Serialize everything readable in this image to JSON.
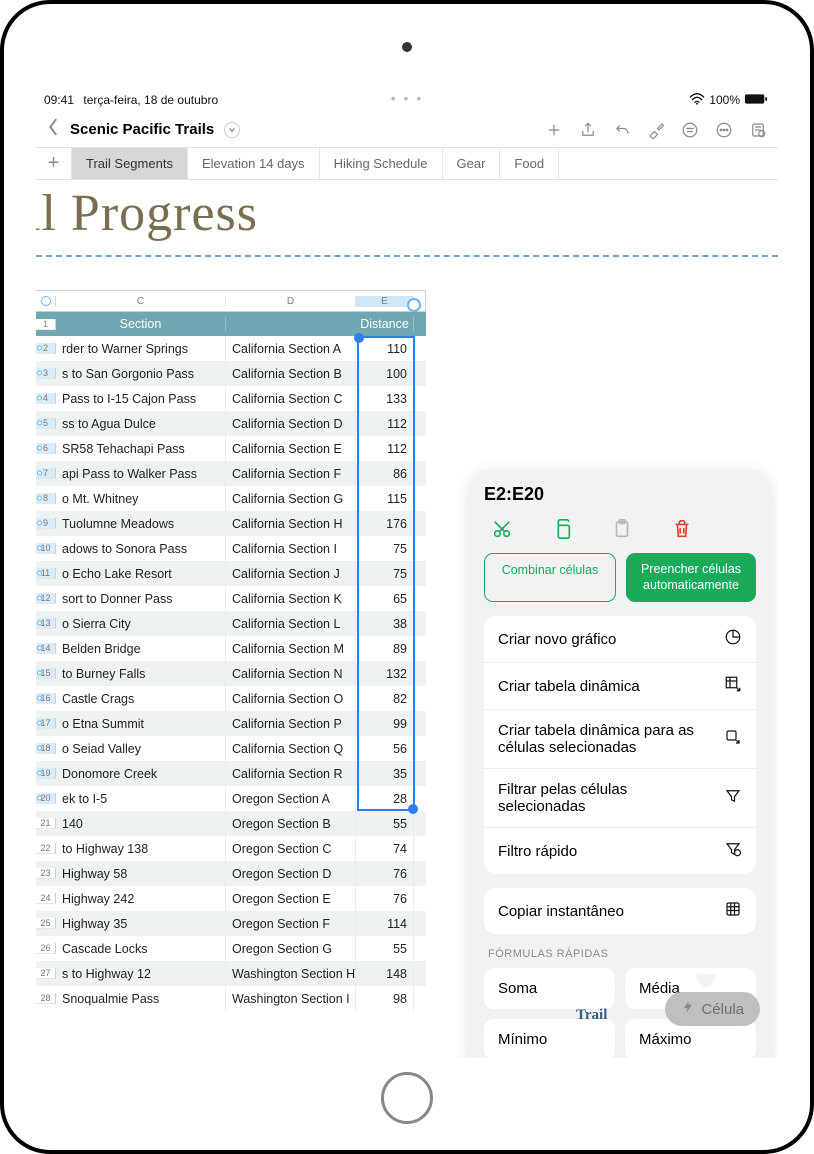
{
  "status": {
    "time": "09:41",
    "date": "terça-feira, 18 de outubro",
    "wifi": "􀙇",
    "battery_pct": "100%"
  },
  "doc": {
    "title": "Scenic Pacific Trails"
  },
  "tabs": {
    "items": [
      "Trail Segments",
      "Elevation 14 days",
      "Hiking Schedule",
      "Gear",
      "Food"
    ],
    "active_index": 0
  },
  "canvas": {
    "big_title": "il Progress"
  },
  "columns": {
    "C": "C",
    "D": "D",
    "E": "E"
  },
  "header_row": {
    "num": "1",
    "section": "Section",
    "distance": "Distance"
  },
  "rows": [
    {
      "n": "2",
      "c": "rder to Warner Springs",
      "d": "California Section A",
      "e": "110",
      "sel": true
    },
    {
      "n": "3",
      "c": "s to San Gorgonio Pass",
      "d": "California Section B",
      "e": "100",
      "sel": true
    },
    {
      "n": "4",
      "c": "Pass to I-15 Cajon Pass",
      "d": "California Section C",
      "e": "133",
      "sel": true
    },
    {
      "n": "5",
      "c": "ss to Agua Dulce",
      "d": "California Section D",
      "e": "112",
      "sel": true
    },
    {
      "n": "6",
      "c": "SR58 Tehachapi Pass",
      "d": "California Section E",
      "e": "112",
      "sel": true
    },
    {
      "n": "7",
      "c": "api Pass to Walker Pass",
      "d": "California Section F",
      "e": "86",
      "sel": true
    },
    {
      "n": "8",
      "c": "o Mt. Whitney",
      "d": "California Section G",
      "e": "115",
      "sel": true
    },
    {
      "n": "9",
      "c": "Tuolumne Meadows",
      "d": "California Section H",
      "e": "176",
      "sel": true
    },
    {
      "n": "10",
      "c": "adows to Sonora Pass",
      "d": "California Section I",
      "e": "75",
      "sel": true
    },
    {
      "n": "11",
      "c": "o Echo Lake Resort",
      "d": "California Section J",
      "e": "75",
      "sel": true
    },
    {
      "n": "12",
      "c": "sort to Donner Pass",
      "d": "California Section K",
      "e": "65",
      "sel": true
    },
    {
      "n": "13",
      "c": "o Sierra City",
      "d": "California Section L",
      "e": "38",
      "sel": true
    },
    {
      "n": "14",
      "c": "Belden Bridge",
      "d": "California Section M",
      "e": "89",
      "sel": true
    },
    {
      "n": "15",
      "c": "to Burney Falls",
      "d": "California Section N",
      "e": "132",
      "sel": true
    },
    {
      "n": "16",
      "c": "Castle Crags",
      "d": "California Section O",
      "e": "82",
      "sel": true
    },
    {
      "n": "17",
      "c": "o Etna Summit",
      "d": "California Section P",
      "e": "99",
      "sel": true
    },
    {
      "n": "18",
      "c": "o Seiad Valley",
      "d": "California Section Q",
      "e": "56",
      "sel": true
    },
    {
      "n": "19",
      "c": "Donomore Creek",
      "d": "California Section R",
      "e": "35",
      "sel": true
    },
    {
      "n": "20",
      "c": "ek to I-5",
      "d": "Oregon Section A",
      "e": "28",
      "sel": true
    },
    {
      "n": "21",
      "c": "140",
      "d": "Oregon Section B",
      "e": "55",
      "sel": false
    },
    {
      "n": "22",
      "c": "to Highway 138",
      "d": "Oregon Section C",
      "e": "74",
      "sel": false
    },
    {
      "n": "23",
      "c": "Highway 58",
      "d": "Oregon Section D",
      "e": "76",
      "sel": false
    },
    {
      "n": "24",
      "c": "Highway 242",
      "d": "Oregon Section E",
      "e": "76",
      "sel": false
    },
    {
      "n": "25",
      "c": "Highway 35",
      "d": "Oregon Section F",
      "e": "114",
      "sel": false
    },
    {
      "n": "26",
      "c": "Cascade Locks",
      "d": "Oregon Section G",
      "e": "55",
      "sel": false
    },
    {
      "n": "27",
      "c": "s to Highway 12",
      "d": "Washington Section H",
      "e": "148",
      "sel": false
    },
    {
      "n": "28",
      "c": "Snoqualmie Pass",
      "d": "Washington Section I",
      "e": "98",
      "sel": false
    }
  ],
  "panel": {
    "range": "E2:E20",
    "combine": "Combinar células",
    "autofill": "Preencher células automaticamente",
    "menu": {
      "new_chart": "Criar novo gráfico",
      "pivot": "Criar tabela dinâmica",
      "pivot_sel": "Criar tabela dinâmica para as células selecionadas",
      "filter_sel": "Filtrar pelas células selecionadas",
      "quick_filter": "Filtro rápido",
      "snapshot": "Copiar instantâneo"
    },
    "formulas_label": "FÓRMULAS RÁPIDAS",
    "formulas": {
      "sum": "Soma",
      "avg": "Média",
      "min": "Mínimo",
      "max": "Máximo"
    }
  },
  "chip": {
    "label": "Célula"
  },
  "watermark": "Trail"
}
